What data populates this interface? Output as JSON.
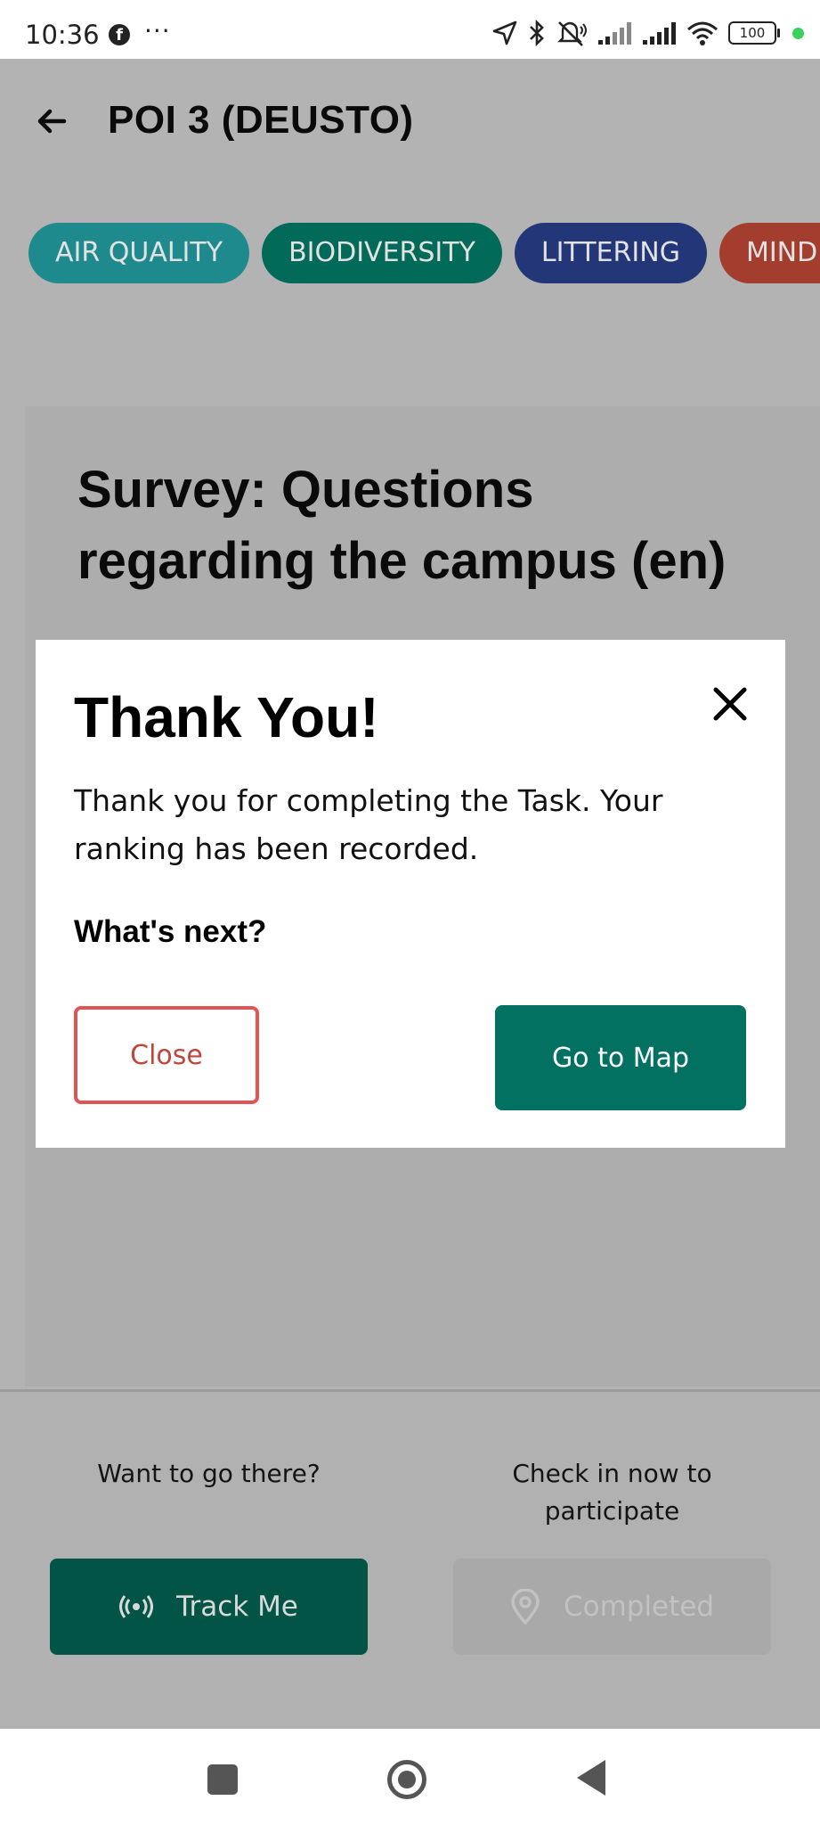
{
  "status_bar": {
    "time": "10:36",
    "overflow": "···",
    "battery": "100",
    "icons": [
      "facebook-icon",
      "location-arrow-icon",
      "bluetooth-icon",
      "mute-icon",
      "signal-icon",
      "signal-icon",
      "wifi-icon",
      "battery-icon"
    ]
  },
  "header": {
    "title": "POI 3 (DEUSTO)",
    "back_icon": "arrow-left-icon"
  },
  "chips": [
    {
      "label": "AIR QUALITY",
      "color": "#1f8a8e"
    },
    {
      "label": "BIODIVERSITY",
      "color": "#016a58"
    },
    {
      "label": "LITTERING",
      "color": "#233778"
    },
    {
      "label": "MINDFULNESS",
      "color": "#a33e2e"
    }
  ],
  "card": {
    "title": "Survey: Questions regarding the campus (en)"
  },
  "bottom": {
    "left_label": "Want to go there?",
    "right_label": "Check in now to participate",
    "track_button": "Track Me",
    "completed_button": "Completed"
  },
  "dialog": {
    "title": "Thank You!",
    "body": "Thank you for completing the Task. Your ranking has been recorded.",
    "next_label": "What's next?",
    "close_button": "Close",
    "map_button": "Go to Map"
  },
  "colors": {
    "primary": "#027161",
    "danger_outline": "#e05454",
    "overlay_gray": "#b3b3b3"
  }
}
